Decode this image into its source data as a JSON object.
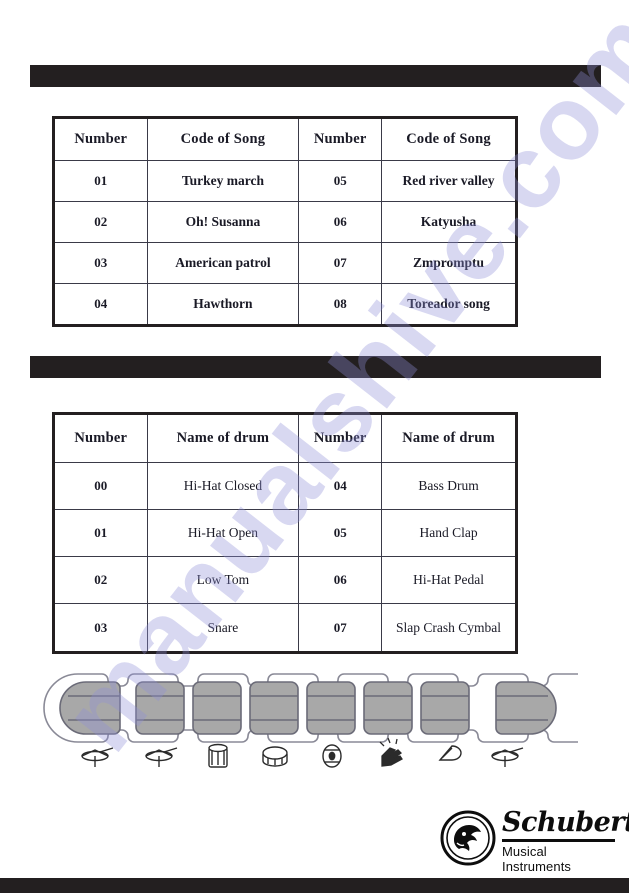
{
  "document": {
    "bars": [
      {
        "name": "song-list-section-bar",
        "label": ""
      },
      {
        "name": "drum-list-section-bar",
        "label": ""
      },
      {
        "name": "footer-bar",
        "label": ""
      }
    ]
  },
  "song_table": {
    "headers": [
      "Number",
      "Code of Song",
      "Number",
      "Code of Song"
    ],
    "rows": [
      [
        "01",
        "Turkey march",
        "05",
        "Red river valley"
      ],
      [
        "02",
        "Oh! Susanna",
        "06",
        "Katyusha"
      ],
      [
        "03",
        "American patrol",
        "07",
        "Zmpromptu"
      ],
      [
        "04",
        "Hawthorn",
        "08",
        "Toreador song"
      ]
    ]
  },
  "drum_table": {
    "headers": [
      "Number",
      "Name of drum",
      "Number",
      "Name of drum"
    ],
    "rows": [
      [
        "00",
        "Hi-Hat Closed",
        "04",
        "Bass Drum"
      ],
      [
        "01",
        "Hi-Hat Open",
        "05",
        "Hand Clap"
      ],
      [
        "02",
        "Low Tom",
        "06",
        "Hi-Hat Pedal"
      ],
      [
        "03",
        "Snare",
        "07",
        "Slap Crash Cymbal"
      ]
    ]
  },
  "pad_diagram": {
    "pad_count": 8,
    "icons": [
      "hi-hat-closed-cymbal-icon",
      "hi-hat-open-cymbal-icon",
      "low-tom-drum-icon",
      "bass-drum-icon",
      "hi-hat-pedal-disc-icon",
      "hand-clap-icon",
      "slap-crash-cymbal-icon",
      "crash-cymbal-icon"
    ],
    "pad_fill": "#a8a8a8",
    "pad_stroke": "#6b6b78",
    "housing_stroke": "#8a8a97"
  },
  "logo": {
    "brand": "Schubert",
    "tagline": "Musical Instruments",
    "mark": "schubert-dog-emblem"
  },
  "watermark": {
    "text": "manualshive.com",
    "color": "#8f8fd8"
  },
  "colors": {
    "bar": "#231f20",
    "table_border": "#231f20",
    "grid_line": "#3a3a48",
    "text": "#1a1a26"
  }
}
